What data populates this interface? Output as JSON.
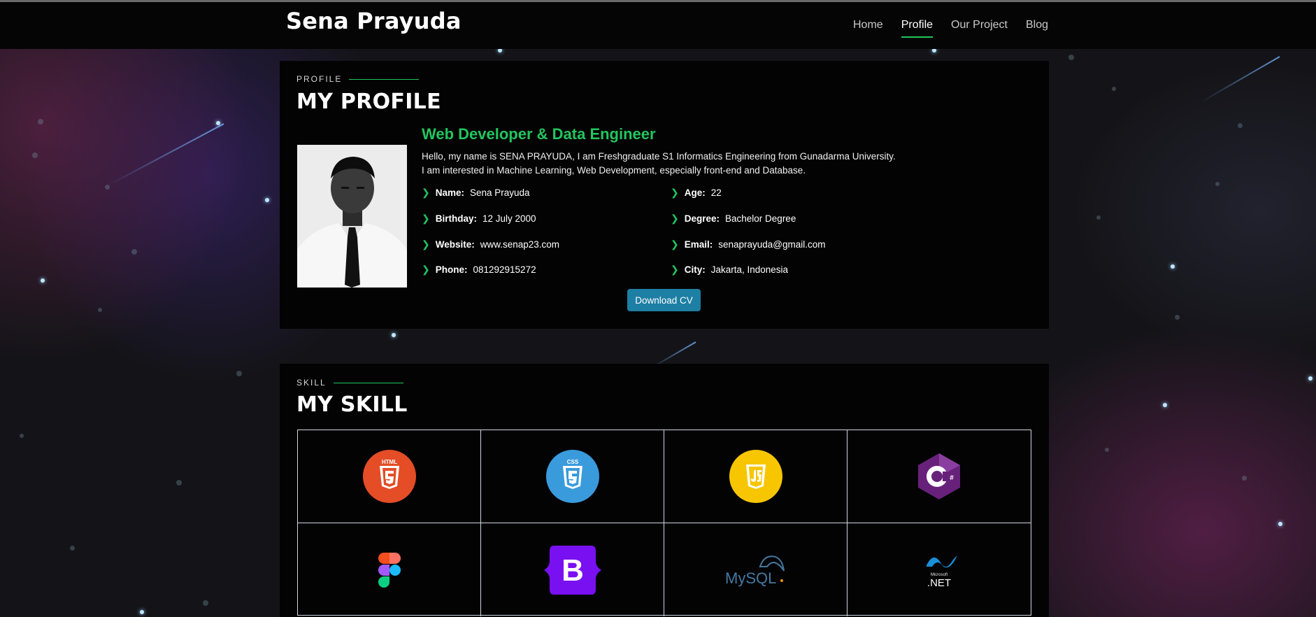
{
  "brand": "Sena Prayuda",
  "nav": [
    "Home",
    "Profile",
    "Our Project",
    "Blog"
  ],
  "nav_active": "Profile",
  "profile": {
    "eyebrow": "PROFILE",
    "title": "MY PROFILE",
    "role": "Web Developer & Data Engineer",
    "bio_line1": "Hello, my name is SENA PRAYUDA, I am Freshgraduate S1 Informatics Engineering from Gunadarma University.",
    "bio_line2": "I am interested in Machine Learning, Web Development, especially front-end and Database.",
    "facts": {
      "name": {
        "label": "Name:",
        "value": "Sena Prayuda"
      },
      "birthday": {
        "label": "Birthday:",
        "value": "12 July 2000"
      },
      "website": {
        "label": "Website:",
        "value": "www.senap23.com"
      },
      "phone": {
        "label": "Phone:",
        "value": "081292915272"
      },
      "age": {
        "label": "Age:",
        "value": "22"
      },
      "degree": {
        "label": "Degree:",
        "value": "Bachelor Degree"
      },
      "email": {
        "label": "Email:",
        "value": "senaprayuda@gmail.com"
      },
      "city": {
        "label": "City:",
        "value": "Jakarta, Indonesia"
      }
    },
    "download_label": "Download CV"
  },
  "skill": {
    "eyebrow": "SKILL",
    "title": "MY SKILL",
    "logos": {
      "html": "HTML",
      "css": "CSS",
      "bootstrap": "B",
      "mysql": "MySQL",
      "dotnet_small": "Microsoft",
      "dotnet": ".NET"
    }
  },
  "colors": {
    "accent": "#22c55e",
    "button": "#1d7fa3",
    "card": "#030304",
    "navbar": "#050505"
  }
}
